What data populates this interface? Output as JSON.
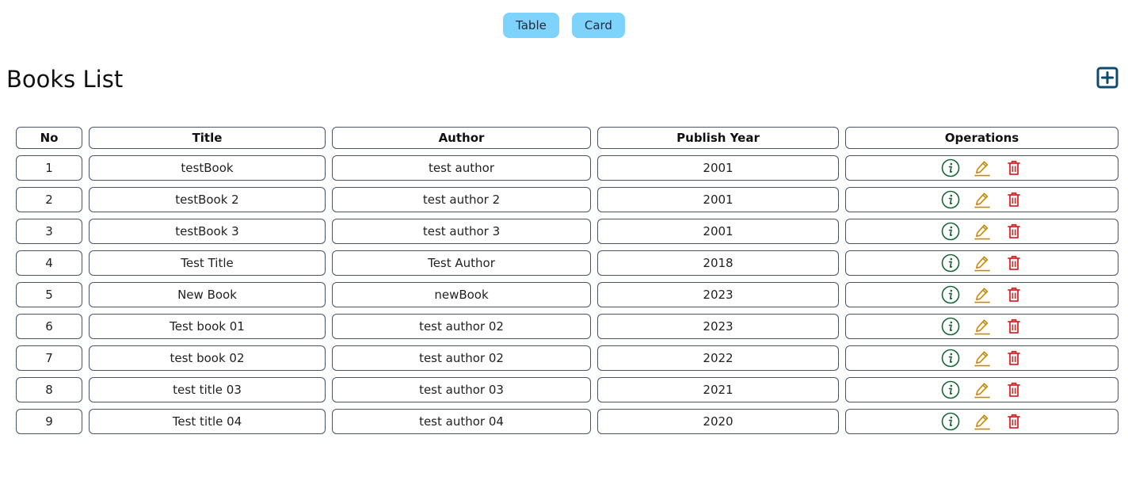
{
  "view_toggle": {
    "table_label": "Table",
    "card_label": "Card"
  },
  "page": {
    "title": "Books List",
    "add_icon": "plus-square-icon"
  },
  "colors": {
    "toggle_bg": "#7dd3fc",
    "info": "#166534",
    "edit": "#ca8a04",
    "delete": "#dc2626",
    "add": "#0c4a6e",
    "border": "#475569"
  },
  "table": {
    "headers": [
      "No",
      "Title",
      "Author",
      "Publish Year",
      "Operations"
    ],
    "rows": [
      {
        "no": "1",
        "title": "testBook",
        "author": "test author",
        "year": "2001"
      },
      {
        "no": "2",
        "title": "testBook 2",
        "author": "test author 2",
        "year": "2001"
      },
      {
        "no": "3",
        "title": "testBook 3",
        "author": "test author 3",
        "year": "2001"
      },
      {
        "no": "4",
        "title": "Test Title",
        "author": "Test Author",
        "year": "2018"
      },
      {
        "no": "5",
        "title": "New Book",
        "author": "newBook",
        "year": "2023"
      },
      {
        "no": "6",
        "title": "Test book 01",
        "author": "test author 02",
        "year": "2023"
      },
      {
        "no": "7",
        "title": "test book 02",
        "author": "test author 02",
        "year": "2022"
      },
      {
        "no": "8",
        "title": "test title 03",
        "author": "test author 03",
        "year": "2021"
      },
      {
        "no": "9",
        "title": "Test title 04",
        "author": "test author 04",
        "year": "2020"
      }
    ],
    "operation_icons": [
      "info-circle-icon",
      "edit-pencil-icon",
      "trash-icon"
    ]
  }
}
